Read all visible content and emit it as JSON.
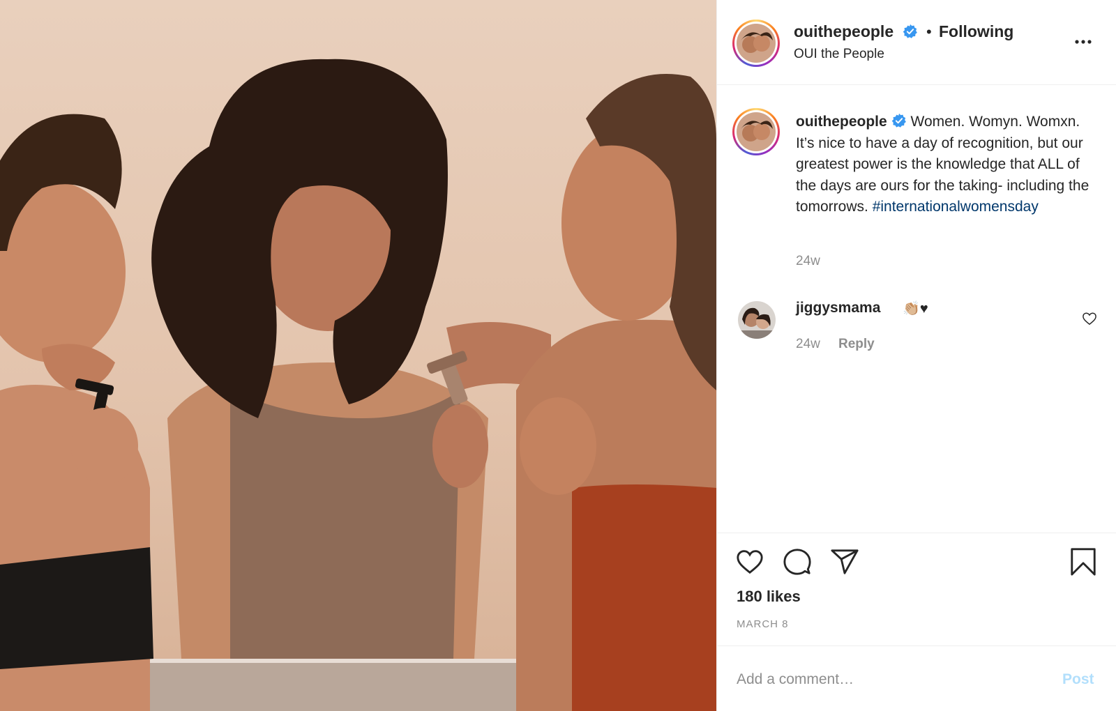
{
  "header": {
    "username": "ouithepeople",
    "separator": "•",
    "follow_state": "Following",
    "display_name": "OUI the People",
    "more_icon": "ellipsis-icon"
  },
  "caption": {
    "username": "ouithepeople",
    "text_1": " Women. Womyn. Womxn. It’s nice to have a day of recognition, but our greatest power is the knowledge that ALL of the days are ours for the taking- including the tomorrows. ",
    "hashtag": "#internationalwomensday",
    "time": "24w"
  },
  "comments": [
    {
      "username": "jiggysmama",
      "emoji": "👏🏼♥",
      "time": "24w",
      "reply_label": "Reply"
    }
  ],
  "actions": {
    "icons": [
      "heart-icon",
      "comment-icon",
      "share-icon",
      "bookmark-icon"
    ],
    "likes": "180 likes",
    "date": "MARCH 8"
  },
  "add_comment": {
    "placeholder": "Add a comment…",
    "post_label": "Post"
  },
  "colors": {
    "verified": "#3897f0",
    "hashtag": "#00376b",
    "post_disabled": "#b2dffc",
    "muted": "#8e8e8e"
  }
}
